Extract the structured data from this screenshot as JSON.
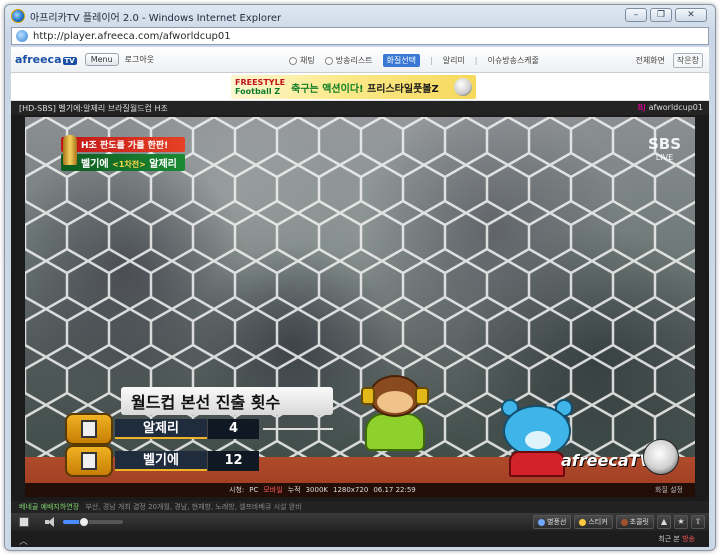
{
  "window": {
    "title": "아프리카TV 플레이어 2.0 - Windows Internet Explorer",
    "url": "http://player.afreeca.com/afworldcup01",
    "buttons": {
      "minimize": "–",
      "restore": "❐",
      "close": "✕"
    }
  },
  "toolbar": {
    "brand": "afreeca",
    "brand_tv": "TV",
    "menu_label": "Menu",
    "logout_label": "로그아웃",
    "options": [
      {
        "label": "채팅",
        "selected": false
      },
      {
        "label": "방송리스트",
        "selected": false
      },
      {
        "label": "화질선택",
        "selected": true
      }
    ],
    "links": [
      "알리미",
      "이슈방송스케줄"
    ],
    "right_buttons": [
      "전체화면",
      "작은창"
    ]
  },
  "banner": {
    "logo_top": "FREESTYLE",
    "logo_bottom": "Football Z",
    "text_a": "축구는 액션이다!",
    "text_b": "프리스타일풋볼Z"
  },
  "player": {
    "stream_title": "[HD-SBS] 벨기에:알제리 브라질월드컵 H조",
    "bj_tag": "BJ",
    "bj_id": "afworldcup01",
    "broadcaster": "SBS",
    "broadcaster_sub": "LIVE",
    "overlay_line1": "H조 판도를 가를 한판!",
    "overlay_team_a": "벨기에",
    "overlay_vs": "<1차전>",
    "overlay_team_b": "알제리",
    "score_title": "월드컵 본선 진출 횟수",
    "rows": [
      {
        "team": "알제리",
        "count": "4"
      },
      {
        "team": "벨기에",
        "count": "12"
      }
    ],
    "watermark": "afreecaTV",
    "info": {
      "viewers_label": "시청:",
      "viewers": "PC",
      "mobile": "모바일",
      "total": "누적",
      "bitrate": "3000K",
      "resolution": "1280x720",
      "datetime": "06.17 22:59",
      "quality": "화질 설정"
    }
  },
  "ticker": {
    "label": "베네골 예배지하연장",
    "text": "부산, 경남 개최 결정 20개월, 경남, 현재항, 노래방, 셀프바베큐 시설 완비"
  },
  "controls": {
    "volume_fraction": 0.35,
    "buttons": [
      "별풍선",
      "스티커",
      "초콜릿"
    ],
    "icon_buttons": [
      "up-icon",
      "star-icon",
      "top-icon"
    ]
  },
  "bottom": {
    "recent_label": "최근 본",
    "recent_hl": "방송"
  },
  "colors": {
    "brand_blue": "#1a4fa6",
    "selected_option": "#3a78d4",
    "turf": "#b04a2b"
  }
}
